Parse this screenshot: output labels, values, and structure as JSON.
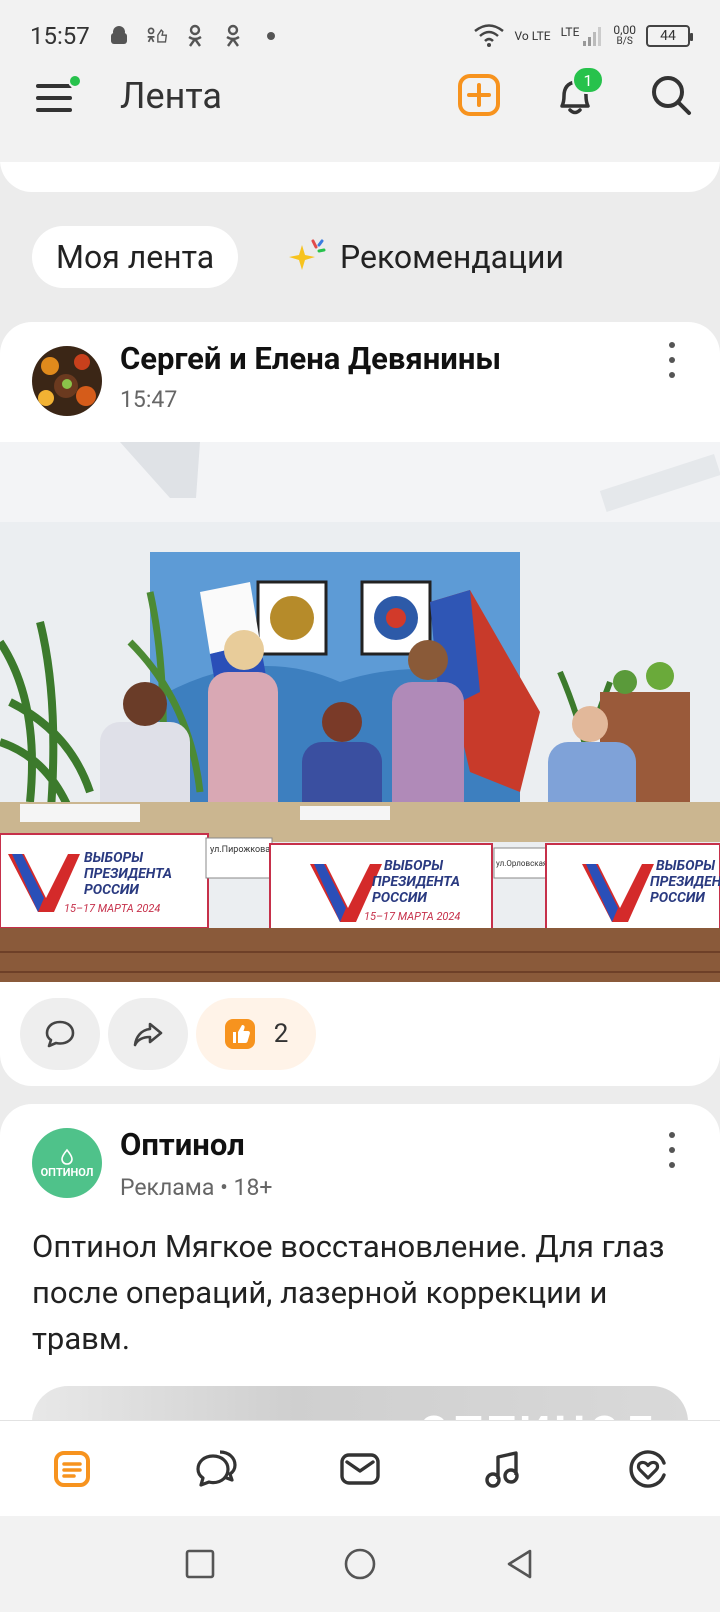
{
  "status_bar": {
    "time": "15:57",
    "network_label": "LTE",
    "volte_label": "Vo LTE",
    "speed_value": "0,00",
    "speed_unit": "B/S",
    "battery": "44"
  },
  "header": {
    "title": "Лента",
    "notification_count": "1"
  },
  "tabs": {
    "my_feed": "Моя лента",
    "recommendations": "Рекомендации"
  },
  "post": {
    "author": "Сергей и Елена Девянины",
    "time": "15:47",
    "like_count": "2",
    "photo_banners": [
      {
        "line1": "ВЫБОРЫ",
        "line2": "ПРЕЗИДЕНТА",
        "line3": "РОССИИ",
        "date": "15–17 МАРТА 2024"
      },
      {
        "line1": "ВЫБОРЫ",
        "line2": "ПРЕЗИДЕНТА",
        "line3": "РОССИИ",
        "date": "15–17 МАРТА 2024"
      },
      {
        "line1": "ВЫБОРЫ",
        "line2": "ПРЕЗИДЕНТА",
        "line3": "РОССИИ",
        "date": ""
      }
    ],
    "sign_labels": [
      "ул.Пирожкова",
      "ул.Орловская"
    ]
  },
  "ad": {
    "brand": "Оптинол",
    "logo_text": "ОПТИНОЛ",
    "meta": "Реклама • 18+",
    "text": "Оптинол Мягкое восстановление. Для глаз после операций, лазерной коррекции и травм.",
    "image_text": "ОПТИНОЛ"
  },
  "bottom_nav": [
    {
      "name": "feed",
      "icon": "feed-icon",
      "active": true
    },
    {
      "name": "discussions",
      "icon": "chat-bubbles-icon",
      "active": false
    },
    {
      "name": "messages",
      "icon": "envelope-icon",
      "active": false
    },
    {
      "name": "music",
      "icon": "music-note-icon",
      "active": false
    },
    {
      "name": "recommendations",
      "icon": "heart-circle-icon",
      "active": false
    }
  ],
  "colors": {
    "accent": "#f7931e",
    "badge_green": "#27c24c",
    "ad_logo": "#4fc28a"
  }
}
